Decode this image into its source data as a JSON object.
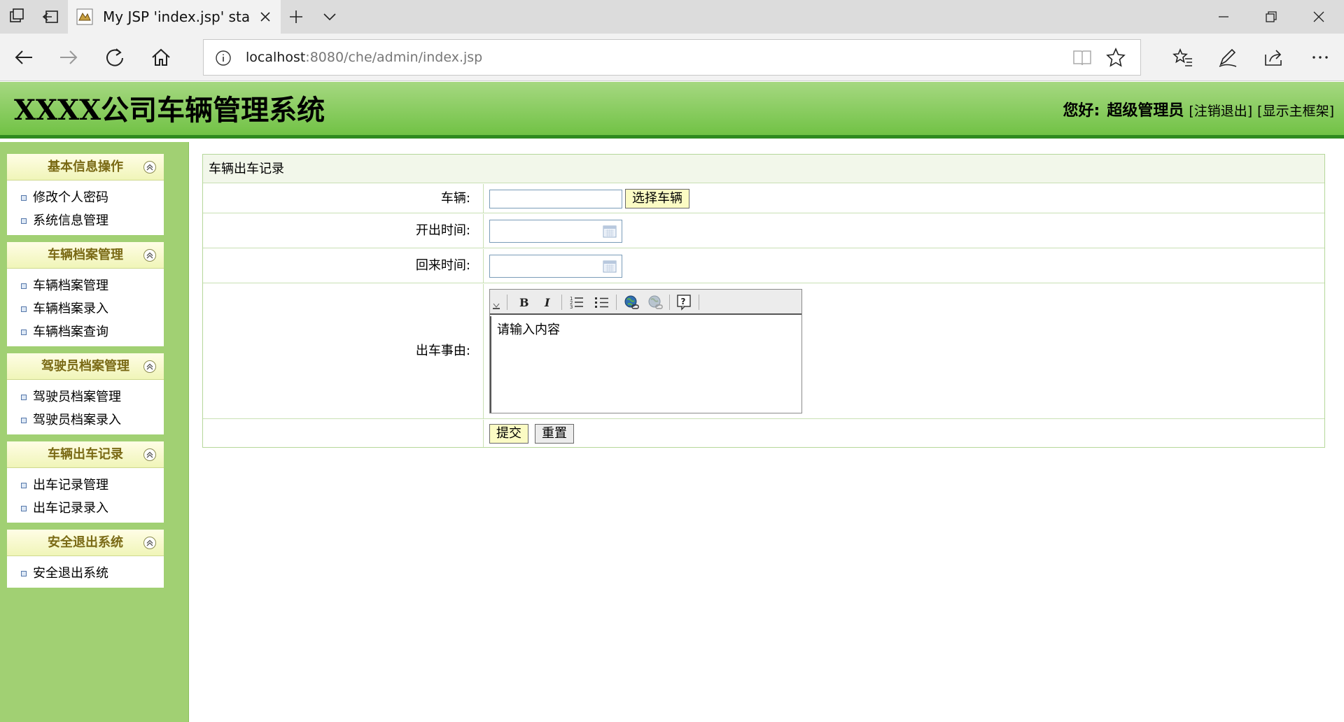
{
  "browser": {
    "tab_title": "My JSP 'index.jsp' startir",
    "url_host": "localhost",
    "url_path": ":8080/che/admin/index.jsp"
  },
  "header": {
    "system_title": "XXXX公司车辆管理系统",
    "greeting": "您好:",
    "username": "超级管理员",
    "logout_link": "[注销退出]",
    "main_frame_link": "[显示主框架]"
  },
  "sidebar": {
    "groups": [
      {
        "title": "基本信息操作",
        "items": [
          "修改个人密码",
          "系统信息管理"
        ]
      },
      {
        "title": "车辆档案管理",
        "items": [
          "车辆档案管理",
          "车辆档案录入",
          "车辆档案查询"
        ]
      },
      {
        "title": "驾驶员档案管理",
        "items": [
          "驾驶员档案管理",
          "驾驶员档案录入"
        ]
      },
      {
        "title": "车辆出车记录",
        "items": [
          "出车记录管理",
          "出车记录录入"
        ]
      },
      {
        "title": "安全退出系统",
        "items": [
          "安全退出系统"
        ]
      }
    ]
  },
  "form": {
    "panel_title": "车辆出车记录",
    "vehicle_label": "车辆:",
    "vehicle_value": "",
    "select_vehicle_button": "选择车辆",
    "depart_time_label": "开出时间:",
    "depart_time_value": "",
    "return_time_label": "回来时间:",
    "return_time_value": "",
    "reason_label": "出车事由:",
    "editor_placeholder": "请输入内容",
    "submit_button": "提交",
    "reset_button": "重置"
  },
  "icons": {
    "bullet_color": "#5577aa",
    "header_green": "#71c245",
    "sidebar_green": "#a1d073"
  }
}
